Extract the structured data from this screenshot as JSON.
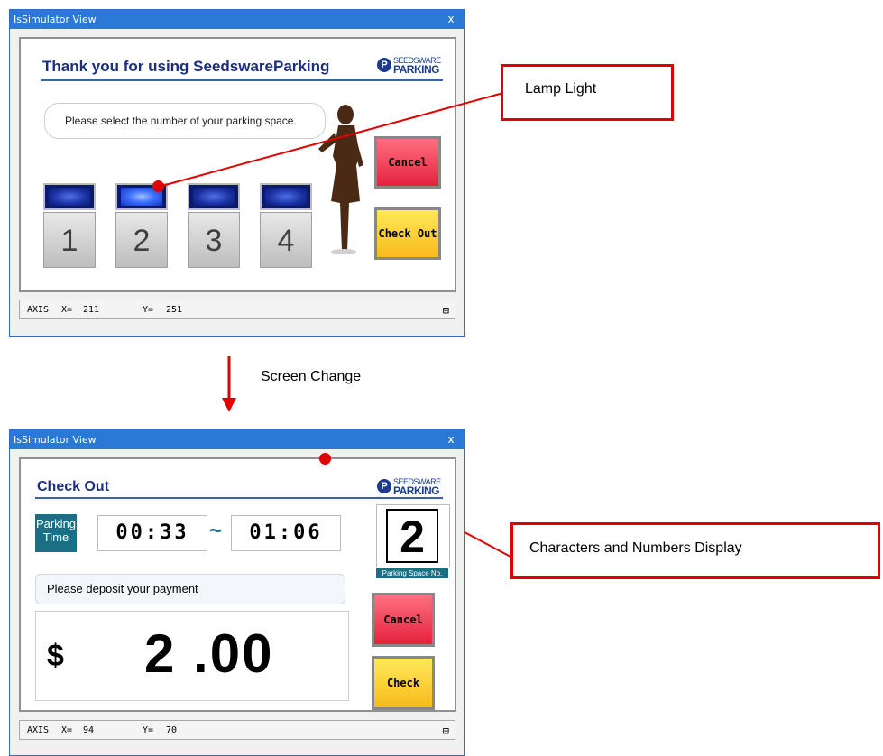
{
  "window1": {
    "title": "IsSimulator View",
    "close": "x",
    "heading": "Thank you for using SeedswareParking",
    "logo": {
      "mark": "P",
      "top": "SEEDSWARE",
      "bottom": "PARKING"
    },
    "instruction": "Please select the number of your parking space.",
    "spaces": [
      {
        "number": "1",
        "lamp_on": false
      },
      {
        "number": "2",
        "lamp_on": true
      },
      {
        "number": "3",
        "lamp_on": false
      },
      {
        "number": "4",
        "lamp_on": false
      }
    ],
    "cancel_label": "Cancel",
    "checkout_label": "Check Out",
    "status": {
      "axis_label": "AXIS",
      "x_label": "X=",
      "x_value": "211",
      "y_label": "Y=",
      "y_value": "251",
      "grid_icon": "⊞"
    }
  },
  "window2": {
    "title": "IsSimulator View",
    "close": "x",
    "heading": "Check Out",
    "logo": {
      "mark": "P",
      "top": "SEEDSWARE",
      "bottom": "PARKING"
    },
    "parking_time_label": "Parking Time",
    "start_time": "00:33",
    "tilde": "~",
    "end_time": "01:06",
    "space_number": "2",
    "space_caption": "Parking Space No.",
    "instruction": "Please deposit your payment",
    "currency": "$",
    "amount": "2 .00",
    "cancel_label": "Cancel",
    "checkout_label": "Check Out",
    "status": {
      "axis_label": "AXIS",
      "x_label": "X=",
      "x_value": "94",
      "y_label": "Y=",
      "y_value": "70",
      "grid_icon": "⊞"
    }
  },
  "annotations": {
    "lamp_light": "Lamp Light",
    "screen_change": "Screen Change",
    "characters_display": "Characters and Numbers Display"
  },
  "colors": {
    "titlebar": "#2a79d7",
    "callout_red": "#e00000",
    "heading_navy": "#1c2e7f",
    "teal_label": "#1b6f85"
  }
}
